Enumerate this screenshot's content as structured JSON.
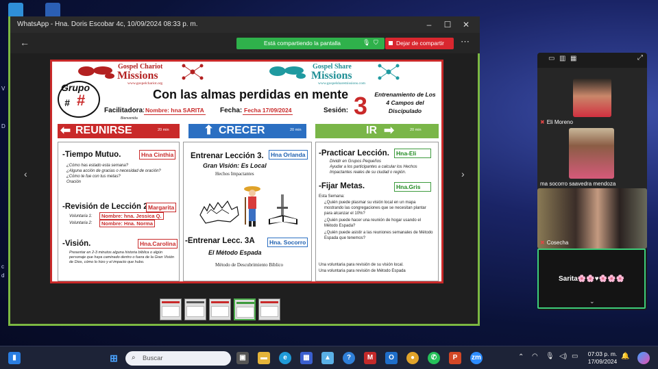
{
  "window": {
    "title": "WhatsApp - Hna. Doris Escobar 4c, 10/09/2024 08:33 p. m.",
    "sharing_status": "Está compartiendo la pantalla",
    "stop_sharing": "Dejar de compartir",
    "accent": "#7cb842",
    "share_color": "#2fb14b",
    "stop_color": "#d9272f"
  },
  "slide": {
    "logo_left": {
      "line1": "Gospel Chariot",
      "line2": "Missions",
      "url": "www.gospelchariot.org"
    },
    "logo_right": {
      "line1": "Gospel Share",
      "line2": "Missions",
      "url": "www.gospelsharemissions.com"
    },
    "grupo_label": "Grupo",
    "grupo_hash": "#",
    "grupo_value": "#",
    "title": "Con las almas perdidas en mente",
    "facilitadora_label": "Facilitadora:",
    "facilitadora_value": "Nombre: hna SARITA",
    "bienvenida": "Bienvenida",
    "fecha_label": "Fecha:",
    "fecha_value": "Fecha 17/09/2024",
    "sesion_label": "Sesión:",
    "sesion_number": "3",
    "training": "Entrenamiento de Los 4 Campos del Discipulado",
    "headers": [
      {
        "label": "REUNIRSE",
        "minutes": "20 min",
        "color": "#c92929"
      },
      {
        "label": "CRECER",
        "minutes": "20 min",
        "color": "#2b6fc2"
      },
      {
        "label": "IR",
        "minutes": "20 min",
        "color": "#7ab648"
      }
    ],
    "col1": {
      "tiempo_title": "-Tiempo Mutuo.",
      "tiempo_name": "Hna Cinthia",
      "tiempo_items": [
        "¿Cómo has estado esta semana?",
        "¿Alguna acción de gracias o necesidad de oración?",
        "¿Cómo te fue con tus metas?",
        "Oración"
      ],
      "revision_title": "-Revisión de Lección 2.",
      "revision_name": "Margarita",
      "vol1_label": "Voluntaria 1:",
      "vol1_value": "Nombre: hna. Jessica Q.",
      "vol2_label": "Voluntaria 2:",
      "vol2_value": "Nombre: Hna. Norma",
      "vision_title": "-Visión.",
      "vision_name": "Hna.Carolina",
      "vision_text": "Presentar en 2-3 minutos alguna historia bíblica o algún personaje que haya caminado dentro o fuera de la Gran Visión de Dios, cómo lo hizo y el impacto que hubo."
    },
    "col2": {
      "entrenar_title": "Entrenar Lección 3.",
      "entrenar_name": "Hna Orlanda",
      "gran_vision": "Gran Visión: Es Local",
      "hechos": "Hechos Impactantes",
      "lecc_title": "-Entrenar Lecc. 3A",
      "lecc_name": "Hna. Socorro",
      "metodo": "El Método Espada",
      "metodo_sub": "Método de Descubrimiento Bíblico"
    },
    "col3": {
      "practicar_title": "-Practicar Lección.",
      "practicar_name": "Hna-Eli",
      "practicar_items": [
        "Dividir en Grupos Pequeños",
        "Ayudar a los participantes a calcular los Hechos Impactantes reales de su ciudad o región."
      ],
      "fijar_title": "-Fijar Metas.",
      "fijar_name": "Hna.Gris",
      "esta_semana": "Esta Semana:",
      "fijar_items": [
        "¿Quién puede plasmar su visión local en un mapa mostrando las congregaciones que se necesitan plantar para alcanzar el 10%?",
        "¿Quién puede hacer una reunión de hogar usando el Método Espada?",
        "¿Quién puede asistir a las reuniones semanales de Método Espada que tenemos?"
      ],
      "vol_vision": "Una voluntaria para revisión de su visión local.",
      "vol_metodo": "Una voluntaria para revisión de Método Espada"
    }
  },
  "participants": [
    {
      "name": "Eli Moreno"
    },
    {
      "name": "ma socorro saavedra mendoza"
    },
    {
      "name": "Cosecha"
    },
    {
      "name": "Sarita🌸🌸♥🌸🌸🌸"
    }
  ],
  "taskbar": {
    "search_placeholder": "Buscar",
    "time": "07:03 p. m.",
    "date": "17/09/2024"
  }
}
